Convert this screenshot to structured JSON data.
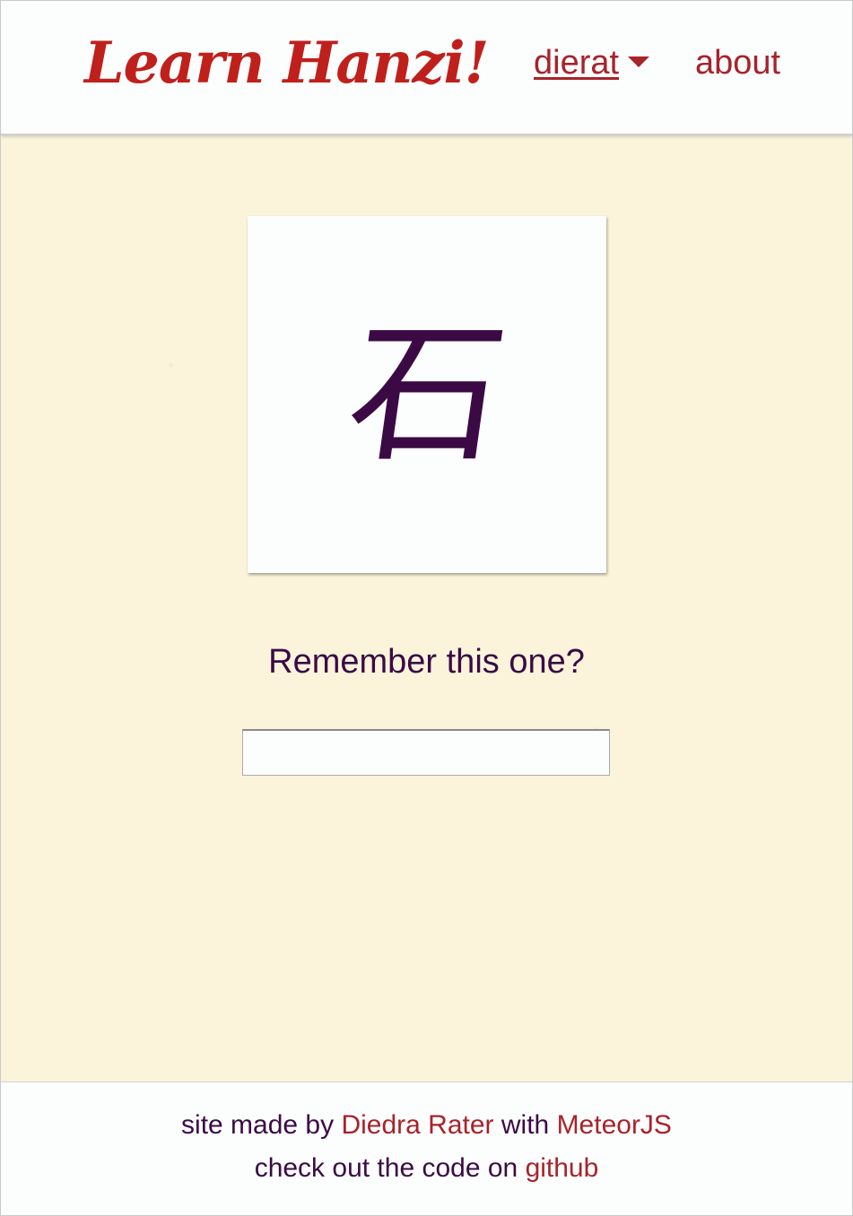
{
  "header": {
    "logo_text": "Learn Hanzi!",
    "user_menu_label": "dierat",
    "about_label": "about"
  },
  "card": {
    "character": "石"
  },
  "prompt": {
    "text": "Remember this one?",
    "input_value": ""
  },
  "footer": {
    "line1": {
      "prefix": "site made by ",
      "author_link": "Diedra Rater",
      "middle": " with ",
      "framework_link": "MeteorJS"
    },
    "line2": {
      "prefix": "check out the code on ",
      "github_link": "github"
    }
  },
  "colors": {
    "brand_red": "#c0201c",
    "link_red": "#a8232a",
    "text_purple": "#3b0a45",
    "paper_background": "#fbf4db"
  },
  "icons": {
    "user_menu_dropdown": "caret-down-icon"
  }
}
